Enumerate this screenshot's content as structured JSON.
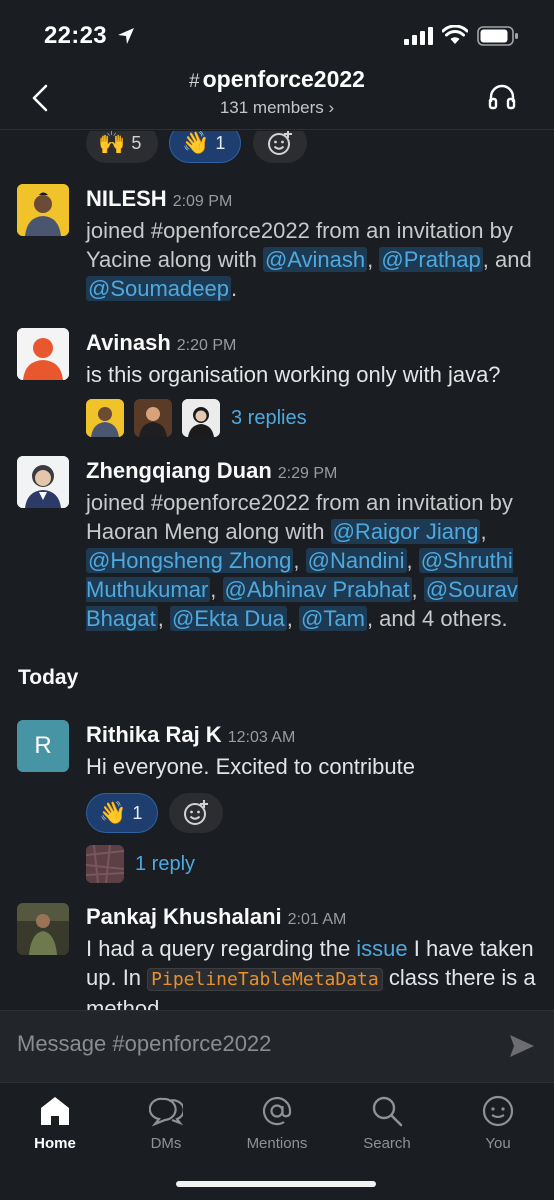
{
  "status": {
    "time": "22:23"
  },
  "header": {
    "hash": "#",
    "channel": "openforce2022",
    "members": "131 members ›"
  },
  "top_reactions": [
    {
      "emoji": "🙌",
      "count": "5"
    },
    {
      "emoji": "👋",
      "count": "1"
    }
  ],
  "messages": [
    {
      "name": "NILESH",
      "time": "2:09 PM",
      "parts": [
        "joined #openforce2022 from an invitation by Yacine along with ",
        "@Avinash",
        ", ",
        "@Prathap",
        ", and ",
        "@Soumadeep",
        "."
      ]
    },
    {
      "name": "Avinash",
      "time": "2:20 PM",
      "text": "is this organisation working only with java?",
      "replies": "3 replies"
    },
    {
      "name": "Zhengqiang Duan",
      "time": "2:29 PM",
      "parts": [
        "joined #openforce2022 from an invitation by Haoran Meng along with ",
        "@Raigor Jiang",
        ", ",
        "@Hongsheng Zhong",
        ", ",
        "@Nandini",
        ", ",
        "@Shruthi Muthukumar",
        ", ",
        "@Abhinav Prabhat",
        ", ",
        "@Sourav Bhagat",
        ", ",
        "@Ekta Dua",
        ", ",
        "@Tam",
        ", and 4 others."
      ]
    },
    {
      "name": "Rithika Raj K",
      "time": "12:03 AM",
      "avatar_letter": "R",
      "text": "Hi everyone. Excited to contribute",
      "reaction": {
        "emoji": "👋",
        "count": "1"
      },
      "replies": "1 reply"
    },
    {
      "name": "Pankaj Khushalani",
      "time": "2:01 AM",
      "t1": "I had a query regarding the ",
      "link": "issue",
      "t2": " I have taken up. In ",
      "code": "PipelineTableMetaData",
      "t3": " class there is a method"
    }
  ],
  "day_divider": "Today",
  "composer": {
    "placeholder": "Message #openforce2022"
  },
  "tabs": [
    {
      "label": "Home",
      "icon": "home-icon"
    },
    {
      "label": "DMs",
      "icon": "dms-icon"
    },
    {
      "label": "Mentions",
      "icon": "mentions-icon"
    },
    {
      "label": "Search",
      "icon": "search-icon"
    },
    {
      "label": "You",
      "icon": "you-icon"
    }
  ],
  "colors": {
    "background": "#1a1d21",
    "mention": "#4ea9df",
    "active_reaction": "#1d3e6e",
    "code": "#e8912d"
  }
}
